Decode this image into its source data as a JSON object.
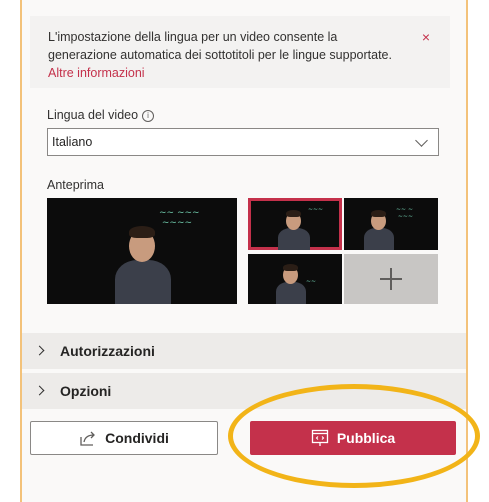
{
  "info": {
    "text": "L'impostazione della lingua per un video consente la generazione automatica dei sottotitoli per le lingue supportate.",
    "link": "Altre informazioni",
    "close_glyph": "×"
  },
  "language": {
    "label": "Lingua del video",
    "info_glyph": "i",
    "value": "Italiano"
  },
  "preview": {
    "label": "Anteprima",
    "add_glyph": "+"
  },
  "sections": {
    "permissions": "Autorizzazioni",
    "options": "Opzioni"
  },
  "actions": {
    "share": "Condividi",
    "publish": "Pubblica"
  },
  "colors": {
    "accent": "#c4314b",
    "highlight": "#f2b418",
    "panel_bg": "#faf9f8"
  }
}
